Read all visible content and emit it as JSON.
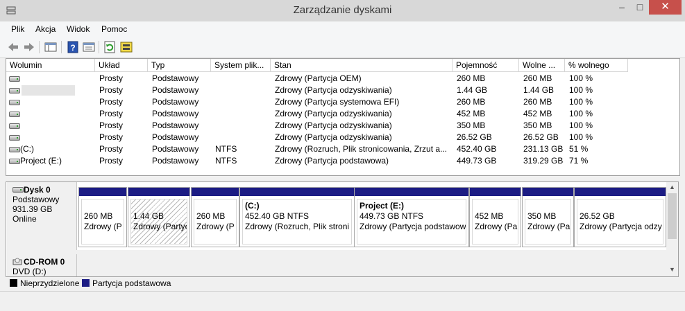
{
  "window": {
    "title": "Zarządzanie dyskami",
    "minimize": "–",
    "maximize": "□",
    "close": "✕"
  },
  "menu": [
    "Plik",
    "Akcja",
    "Widok",
    "Pomoc"
  ],
  "columns": [
    "Wolumin",
    "Układ",
    "Typ",
    "System plik...",
    "Stan",
    "Pojemność",
    "Wolne ...",
    "% wolnego"
  ],
  "volumes": [
    {
      "name": "",
      "layout": "Prosty",
      "type": "Podstawowy",
      "fs": "",
      "status": "Zdrowy (Partycja OEM)",
      "capacity": "260 MB",
      "free": "260 MB",
      "pct": "100 %"
    },
    {
      "name": "",
      "layout": "Prosty",
      "type": "Podstawowy",
      "fs": "",
      "status": "Zdrowy (Partycja odzyskiwania)",
      "capacity": "1.44 GB",
      "free": "1.44 GB",
      "pct": "100 %"
    },
    {
      "name": "",
      "layout": "Prosty",
      "type": "Podstawowy",
      "fs": "",
      "status": "Zdrowy (Partycja systemowa EFI)",
      "capacity": "260 MB",
      "free": "260 MB",
      "pct": "100 %"
    },
    {
      "name": "",
      "layout": "Prosty",
      "type": "Podstawowy",
      "fs": "",
      "status": "Zdrowy (Partycja odzyskiwania)",
      "capacity": "452 MB",
      "free": "452 MB",
      "pct": "100 %"
    },
    {
      "name": "",
      "layout": "Prosty",
      "type": "Podstawowy",
      "fs": "",
      "status": "Zdrowy (Partycja odzyskiwania)",
      "capacity": "350 MB",
      "free": "350 MB",
      "pct": "100 %"
    },
    {
      "name": "",
      "layout": "Prosty",
      "type": "Podstawowy",
      "fs": "",
      "status": "Zdrowy (Partycja odzyskiwania)",
      "capacity": "26.52 GB",
      "free": "26.52 GB",
      "pct": "100 %"
    },
    {
      "name": "(C:)",
      "layout": "Prosty",
      "type": "Podstawowy",
      "fs": "NTFS",
      "status": "Zdrowy (Rozruch, Plik stronicowania, Zrzut a...",
      "capacity": "452.40 GB",
      "free": "231.13 GB",
      "pct": "51 %"
    },
    {
      "name": "Project (E:)",
      "layout": "Prosty",
      "type": "Podstawowy",
      "fs": "NTFS",
      "status": "Zdrowy (Partycja podstawowa)",
      "capacity": "449.73 GB",
      "free": "319.29 GB",
      "pct": "71 %"
    }
  ],
  "disk0": {
    "name": "Dysk 0",
    "type": "Podstawowy",
    "size": "931.39 GB",
    "state": "Online"
  },
  "partitions": [
    {
      "title": "",
      "size": "260 MB",
      "status": "Zdrowy (P",
      "hatched": false
    },
    {
      "title": "",
      "size": "1.44 GB",
      "status": "Zdrowy (Partyc",
      "hatched": true
    },
    {
      "title": "",
      "size": "260 MB",
      "status": "Zdrowy (P",
      "hatched": false
    },
    {
      "title": "(C:)",
      "size": "452.40 GB NTFS",
      "status": "Zdrowy (Rozruch, Plik stroni",
      "hatched": false
    },
    {
      "title": "Project  (E:)",
      "size": "449.73 GB NTFS",
      "status": "Zdrowy (Partycja podstawow",
      "hatched": false
    },
    {
      "title": "",
      "size": "452 MB",
      "status": "Zdrowy (Pa",
      "hatched": false
    },
    {
      "title": "",
      "size": "350 MB",
      "status": "Zdrowy (Pa",
      "hatched": false
    },
    {
      "title": "",
      "size": "26.52 GB",
      "status": "Zdrowy (Partycja odzy",
      "hatched": false
    }
  ],
  "cdrom": {
    "name": "CD-ROM 0",
    "type": "DVD (D:)"
  },
  "legend": [
    {
      "label": "Nieprzydzielone",
      "color": "#000000"
    },
    {
      "label": "Partycja podstawowa",
      "color": "#1c1c84"
    }
  ],
  "colors": {
    "primary_partition": "#1c1c84",
    "close_button": "#c7504b"
  }
}
